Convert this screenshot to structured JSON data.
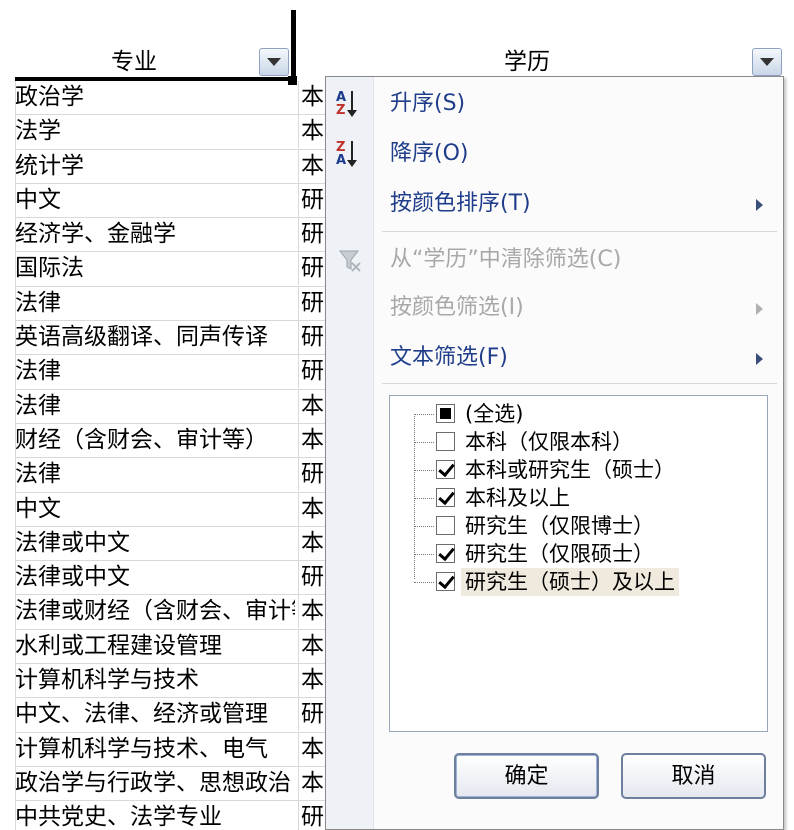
{
  "sheet": {
    "headers": {
      "major": "专业",
      "education": "学历"
    },
    "rows": [
      {
        "major": "政治学",
        "edu": "本"
      },
      {
        "major": "法学",
        "edu": "本"
      },
      {
        "major": "统计学",
        "edu": "本"
      },
      {
        "major": "中文",
        "edu": "研"
      },
      {
        "major": "经济学、金融学",
        "edu": "研"
      },
      {
        "major": "国际法",
        "edu": "研"
      },
      {
        "major": "法律",
        "edu": "研"
      },
      {
        "major": "英语高级翻译、同声传译",
        "edu": "研"
      },
      {
        "major": "法律",
        "edu": "研"
      },
      {
        "major": "法律",
        "edu": "本"
      },
      {
        "major": "财经（含财会、审计等）",
        "edu": "本"
      },
      {
        "major": "法律",
        "edu": "研"
      },
      {
        "major": "中文",
        "edu": "本"
      },
      {
        "major": "法律或中文",
        "edu": "本"
      },
      {
        "major": "法律或中文",
        "edu": "研"
      },
      {
        "major": "法律或财经（含财会、审计等）",
        "edu": "本"
      },
      {
        "major": "水利或工程建设管理",
        "edu": "本"
      },
      {
        "major": "计算机科学与技术",
        "edu": "本"
      },
      {
        "major": "中文、法律、经济或管理",
        "edu": "研"
      },
      {
        "major": "计算机科学与技术、电气",
        "edu": "本"
      },
      {
        "major": "政治学与行政学、思想政治",
        "edu": "本"
      },
      {
        "major": "中共党史、法学专业",
        "edu": "研"
      }
    ]
  },
  "menu": {
    "sort_asc": "升序(S)",
    "sort_desc": "降序(O)",
    "sort_by_color": "按颜色排序(T)",
    "clear_filter": "从“学历”中清除筛选(C)",
    "filter_by_color": "按颜色筛选(I)",
    "text_filter": "文本筛选(F)",
    "icons": {
      "asc_top": "A",
      "asc_bottom": "Z",
      "desc_top": "Z",
      "desc_bottom": "A"
    }
  },
  "filter_list": [
    {
      "label": "(全选)",
      "state": "partial"
    },
    {
      "label": "本科（仅限本科）",
      "state": "unchecked"
    },
    {
      "label": "本科或研究生（硕士）",
      "state": "checked"
    },
    {
      "label": "本科及以上",
      "state": "checked"
    },
    {
      "label": "研究生（仅限博士）",
      "state": "unchecked"
    },
    {
      "label": "研究生（仅限硕士）",
      "state": "checked"
    },
    {
      "label": "研究生（硕士）及以上",
      "state": "checked"
    }
  ],
  "buttons": {
    "ok": "确定",
    "cancel": "取消"
  }
}
